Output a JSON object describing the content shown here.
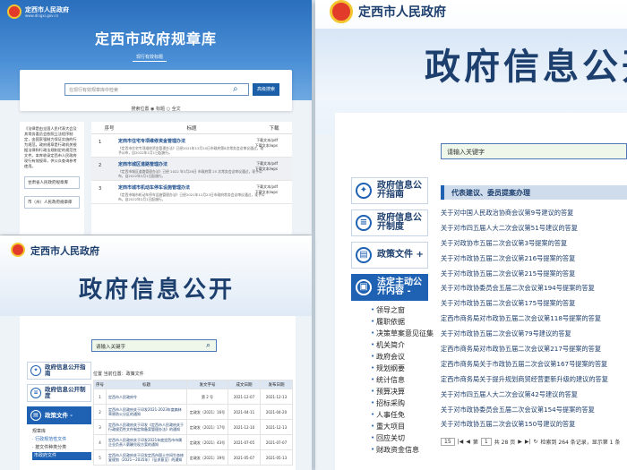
{
  "panel_a": {
    "site_name": "定西市人民政府",
    "site_url": "www.dingxi.gov.cn",
    "title": "定西市政府规章库",
    "subtitle": "现行有效标题",
    "search_placeholder": "在现行有效规章库中检索",
    "search_button": "高级搜索",
    "search_scope_label": "搜索位置",
    "scope_title": "标题",
    "scope_full": "全文",
    "intro": "《法律是由全国人民代表大会及其常务委员会依照立法程序制定，由国家强制力保证实施的行为规范。政府规章是行政机关根据法律和行政法规制定的规范性文件。本库收录定西市人民政府现行有效规章，供公众查询参考使用。",
    "left_buttons": [
      "甘肃省人民政府规章库",
      "市（州）人民政府规章库"
    ],
    "table_headers": [
      "序号",
      "标题",
      "下载"
    ],
    "rows": [
      {
        "no": "1",
        "title": "定西市住宅专项维修资金管理办法",
        "desc": "《定西市住宅专项维修资金管理办法》已经2021年12月10日市政府第8次常务会议审议通过，现予公布，自2022年1月1日起施行。",
        "dl1": "下载文本/pdf",
        "dl2": "下载文本/wps"
      },
      {
        "no": "2",
        "title": "定西市城区道路管理办法",
        "desc": "《定西市城区道路管理办法》已经 2022 年3月26日 市政府第 25 次常务会议审议通过，现予公布，自2022年5月1日起施行。",
        "dl1": "下载文本/pdf",
        "dl2": "下载文本/wps"
      },
      {
        "no": "3",
        "title": "定西市城市机动车停车设施管理办法",
        "desc": "《定西市城市机动车停车设施管理办法》已经2021年12月23日市政府常务会议审议通过，现予公布，自2022年2月1日起施行。",
        "dl1": "下载文本/pdf",
        "dl2": "下载文本/wps"
      }
    ]
  },
  "panel_b": {
    "site_name": "定西市人民政府",
    "title": "政府信息公开",
    "search_placeholder": "请输入关键字",
    "menu": [
      {
        "label": "政府信息公开指南",
        "icon": "compass-icon",
        "glyph": "✦"
      },
      {
        "label": "政府信息公开制度",
        "icon": "list-icon",
        "glyph": "≡"
      },
      {
        "label": "政策文件 +",
        "icon": "document-icon",
        "glyph": "▤"
      },
      {
        "label": "法定主动公开内容 -",
        "icon": "folder-icon",
        "glyph": "▣"
      }
    ],
    "submenu": [
      "领导之窗",
      "履职依据",
      "决策草案意见征集",
      "机关简介",
      "政府会议",
      "规划纲要",
      "统计信息",
      "预算决算",
      "招标采购",
      "人事任免",
      "重大项目",
      "回应关切",
      "财政资金信息"
    ],
    "section_title": "代表建议、委员提案办理",
    "links": [
      "关于对中国人民政治协商会议第9号建议的答复",
      "关于对市四五届人大二次会议第51号建议的答复",
      "关于对政协市五届二次会议第3号提案的答复",
      "关于对市政协五届二次会议第216号提案的答复",
      "关于对市政协五届二次会议第215号提案的答复",
      "关于对市政协委员会五届二次会议第194号提案的答复",
      "关于对市政协五届二次会议第175号提案的答复",
      "定西市商务局对市政协五届二次会议第118号提案的答复",
      "关于对市政协五届二次会议第79号建议的答复",
      "定西市商务局对市政协五届二次会议第217号提案的答复",
      "定西市商务局关于市政协五届二次会议第167号提案的答复",
      "定西市商务局关于提升规划商贸经营更新升级的建议的答复",
      "关于对市四五届人大二次会议第42号建议的答复",
      "关于对市政协委员会五届二次会议第154号提案的答复",
      "关于对市政协五届二次会议第150号建议的答复"
    ],
    "pager": {
      "size": "15",
      "page_label": "第",
      "page": "1",
      "of_pages": "共 28 页",
      "status": "检索到 264 条记录，显示第 1 条"
    }
  },
  "panel_c": {
    "site_name": "定西市人民政府",
    "title": "政府信息公开",
    "search_placeholder": "请输入关键字",
    "menu": [
      {
        "label": "政府信息公开指南",
        "icon": "compass-icon",
        "glyph": "✦"
      },
      {
        "label": "政府信息公开制度",
        "icon": "list-icon",
        "glyph": "≡"
      },
      {
        "label": "政策文件 -",
        "icon": "document-icon",
        "glyph": "▤"
      }
    ],
    "submenu": [
      "规章库",
      "· 行政规范性文件",
      "· 按文件种类分类",
      "市政府文件"
    ],
    "crumb": "位置 当前位置：政策文件",
    "headers": [
      "序号",
      "标题",
      "发文字号",
      "成文日期",
      "发布日期"
    ],
    "rows": [
      [
        "1",
        "定西市人民政府令",
        "第 2 号",
        "2021-12-07",
        "2021-12-13"
      ],
      [
        "2",
        "定西市人民政府关于印发2021-2023年度森林草原防火分区的通知",
        "定政发〔2021〕16号",
        "2021-04-11",
        "2021-04-20"
      ],
      [
        "3",
        "定西市人民政府关于印发《定西市人民政府关于行政规范性文件制定和备案管理办法》的通知",
        "定政发〔2021〕17号",
        "2021-12-10",
        "2021-12-13"
      ],
      [
        "4",
        "定西市人民政府关于印发2021年度定西市市属企业负责人薪酬兑现方案的通知",
        "定政发〔2021〕43号",
        "2021-07-05",
        "2021-07-07"
      ],
      [
        "5",
        "定西市人民政府关于印发定西市国土空间生态修复规划（2021—2035年）（征求意见）的通知",
        "定政发〔2021〕39号",
        "2021-05-07",
        "2021-05-13"
      ]
    ]
  }
}
